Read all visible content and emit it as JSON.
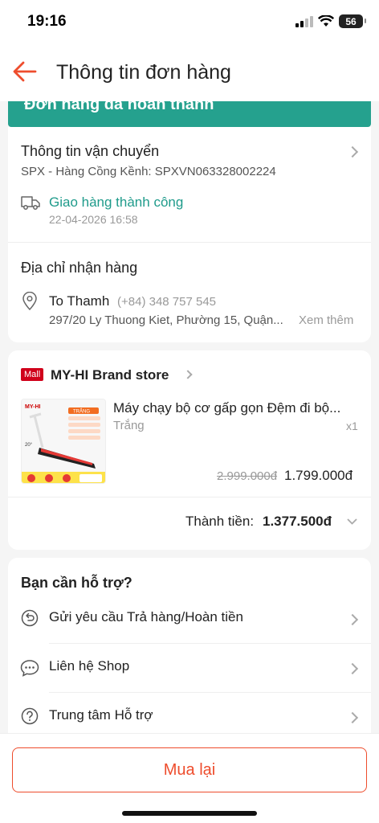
{
  "status_bar": {
    "time": "19:16",
    "battery": "56"
  },
  "header": {
    "title": "Thông tin đơn hàng"
  },
  "banner": {
    "text": "Đơn hàng đã hoàn thành"
  },
  "shipping": {
    "title": "Thông tin vận chuyển",
    "carrier": "SPX - Hàng Cồng Kềnh: SPXVN063328002224",
    "status": "Giao hàng thành công",
    "status_time": "22-04-2026 16:58"
  },
  "address": {
    "title": "Địa chỉ nhận hàng",
    "name": "To Thamh",
    "phone": "(+84) 348 757 545",
    "line": "297/20 Ly Thuong Kiet, Phường 15, Quận...",
    "more": "Xem thêm"
  },
  "store": {
    "badge": "Mall",
    "name": "MY-HI Brand store",
    "product_name": "Máy chạy bộ cơ gấp gọn Đệm đi bộ...",
    "variant": "Trắng",
    "qty": "x1",
    "old_price": "2.999.000đ",
    "price": "1.799.000đ",
    "total_label": "Thành tiền:",
    "total_value": "1.377.500đ",
    "image_texts": {
      "brand": "MY-HI",
      "color_tag": "TRẮNG",
      "angle": "20°"
    }
  },
  "help": {
    "title": "Bạn cần hỗ trợ?",
    "items": [
      {
        "label": "Gửi yêu cầu Trả hàng/Hoàn tiền"
      },
      {
        "label": "Liên hệ Shop"
      },
      {
        "label": "Trung tâm Hỗ trợ"
      }
    ]
  },
  "bottom": {
    "rebuy_label": "Mua lại"
  },
  "colors": {
    "accent": "#ee4d2d",
    "teal": "#25a18e",
    "mall": "#d0011b"
  }
}
